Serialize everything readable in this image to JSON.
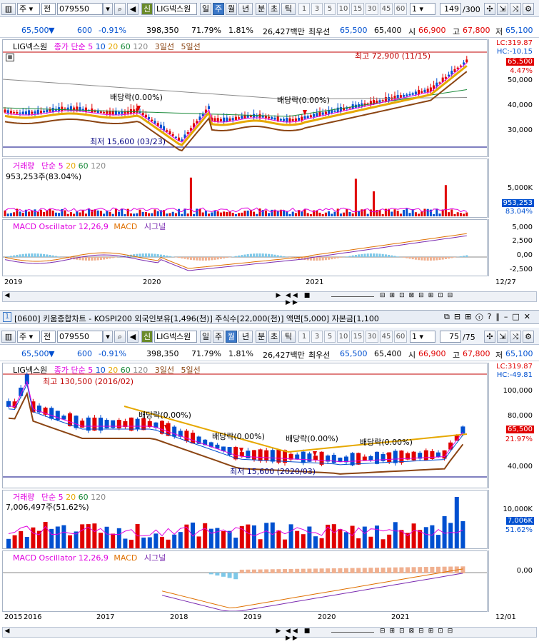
{
  "top": {
    "toolbar": {
      "market": "주",
      "period_label": "전",
      "code": "079550",
      "new_badge": "신",
      "name": "LIG넥스원",
      "tabs": [
        "일",
        "주",
        "월",
        "년",
        "분",
        "초",
        "틱"
      ],
      "selected_tab": "주",
      "numbers": [
        "1",
        "3",
        "5",
        "10",
        "15",
        "30",
        "45",
        "60"
      ],
      "mult": "1",
      "counter": "149",
      "counter_total": "/300"
    },
    "price": {
      "price": "65,500",
      "down_arrow": "▼",
      "change": "600",
      "rate": "-0.91%",
      "volume": "398,350",
      "ratio": "71.79%",
      "turnover": "1.81%",
      "amount": "26,427백만",
      "best_label": "최우선",
      "best_ask": "65,500",
      "best_bid": "65,400",
      "open_label": "시",
      "open": "66,900",
      "high_label": "고",
      "high": "67,800",
      "low_label": "저",
      "low": "65,100"
    },
    "chart": {
      "legend_name": "LIG넥스원",
      "legend_ma": "종가 단순",
      "ma": [
        "5",
        "10",
        "20",
        "60",
        "120"
      ],
      "env3": "3일선",
      "env5": "5일선",
      "max_label": "최고 72,900 (11/15)",
      "min_label": "최저 15,600 (03/23)",
      "dividend1": "배당락(0.00%)",
      "dividend2": "배당락(0.00%)",
      "lc": "LC:319.87",
      "hc": "HC:-10.15",
      "cur_price": "65,500",
      "cur_rate": "4.47%",
      "y_ticks": [
        "50,000",
        "40,000",
        "30,000"
      ]
    },
    "volume": {
      "legend": "거래량",
      "legend_ma": "단순",
      "ma": [
        "5",
        "20",
        "60",
        "120"
      ],
      "value": "953,253주(83.04%)",
      "y_tick": "5,000K",
      "badge_val": "953,253",
      "badge_rate": "83.04%"
    },
    "macd": {
      "legend": "MACD Oscillator 12,26,9",
      "macd": "MACD",
      "signal": "시그널",
      "y_ticks": [
        "5,000",
        "2,500",
        "0,00",
        "-2,500"
      ]
    },
    "dates": [
      "2019",
      "2020",
      "2021"
    ],
    "end_date": "12/27"
  },
  "separator": {
    "index": "1",
    "text": "[0600] 키움종합차트 - KOSPI200 외국인보유[1,496(천)] 주식수[22,000(천)] 액면[5,000] 자본금[1,100"
  },
  "bottom": {
    "toolbar": {
      "market": "주",
      "period_label": "전",
      "code": "079550",
      "new_badge": "신",
      "name": "LIG넥스원",
      "tabs": [
        "일",
        "주",
        "월",
        "년",
        "분",
        "초",
        "틱"
      ],
      "selected_tab": "월",
      "numbers": [
        "1",
        "3",
        "5",
        "10",
        "15",
        "30",
        "45",
        "60"
      ],
      "mult": "1",
      "counter": "75",
      "counter_total": "/75"
    },
    "price": {
      "price": "65,500",
      "down_arrow": "▼",
      "change": "600",
      "rate": "-0.91%",
      "volume": "398,350",
      "ratio": "71.79%",
      "turnover": "1.81%",
      "amount": "26,427백만",
      "best_label": "최우선",
      "best_ask": "65,500",
      "best_bid": "65,400",
      "open_label": "시",
      "open": "66,900",
      "high_label": "고",
      "high": "67,800",
      "low_label": "저",
      "low": "65,100"
    },
    "chart": {
      "legend_name": "LIG넥스원",
      "legend_ma": "종가 단순",
      "ma": [
        "5",
        "10",
        "20",
        "60",
        "120"
      ],
      "env3": "3일선",
      "env5": "5일선",
      "max_label": "최고 130,500 (2016/02)",
      "min_label": "최저 15,600 (2020/03)",
      "dividends": [
        "배당락(0.00%)",
        "배당락(0.00%)",
        "배당락(0.00%)",
        "배당락(0.00%)"
      ],
      "lc": "LC:319.87",
      "hc": "HC:-49.81",
      "cur_price": "65,500",
      "cur_rate": "21.97%",
      "y_ticks": [
        "100,000",
        "80,000",
        "60,000",
        "40,000"
      ]
    },
    "volume": {
      "legend": "거래량",
      "legend_ma": "단순",
      "ma": [
        "5",
        "20",
        "60",
        "120"
      ],
      "value": "7,006,497주(51.62%)",
      "y_tick": "10,000K",
      "badge_val": "7,006K",
      "badge_rate": "51.62%"
    },
    "macd": {
      "legend": "MACD Oscillator 12,26,9",
      "macd": "MACD",
      "signal": "시그널",
      "y_ticks": [
        "0,00"
      ]
    },
    "dates": [
      "2015",
      "2016",
      "2017",
      "2018",
      "2019",
      "2020",
      "2021"
    ],
    "end_date": "12/01"
  },
  "colors": {
    "up": "#e00000",
    "down": "#0050d0",
    "ma5": "#e000e0",
    "ma20": "#e6a800",
    "ma60": "#1a8a3a",
    "ma120": "#8a8a8a",
    "env": "#8b4513",
    "hline": "#c00000",
    "lowline": "#000080"
  }
}
